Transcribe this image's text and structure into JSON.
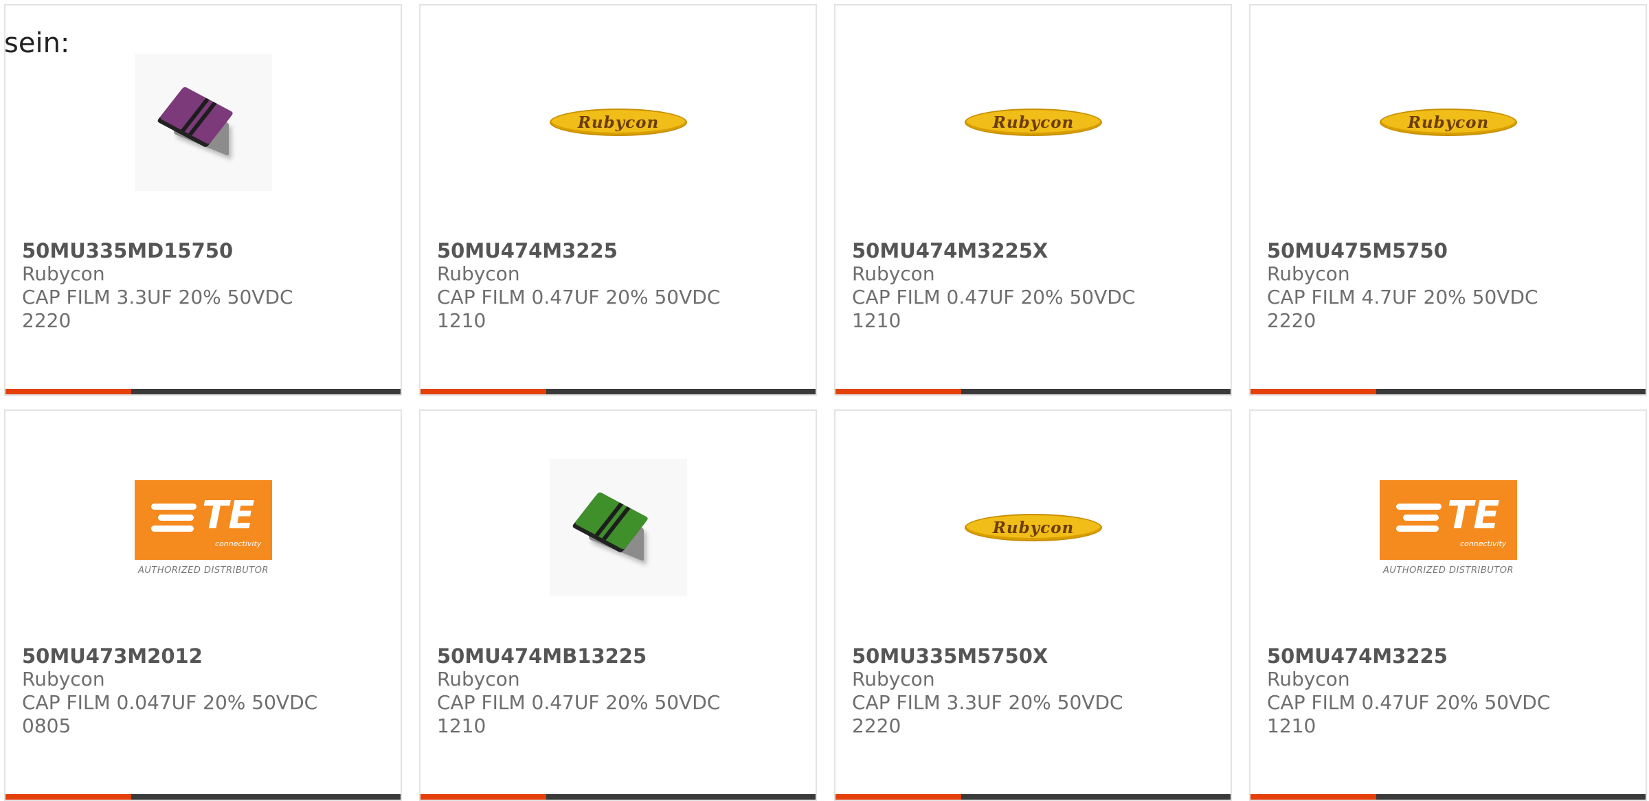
{
  "intro_text": "sein:",
  "colors": {
    "accent": "#e4400c",
    "bar": "#3a3a3a",
    "te_orange": "#f58a1f",
    "rubycon_yellow": "#f1bd18"
  },
  "products": [
    {
      "part": "50MU335MD15750",
      "brand": "Rubycon",
      "desc": "CAP FILM 3.3UF 20% 50VDC",
      "package": "2220",
      "image": "chip-purple"
    },
    {
      "part": "50MU474M3225",
      "brand": "Rubycon",
      "desc": "CAP FILM 0.47UF 20% 50VDC",
      "package": "1210",
      "image": "rubycon-logo",
      "logo_text": "Rubycon"
    },
    {
      "part": "50MU474M3225X",
      "brand": "Rubycon",
      "desc": "CAP FILM 0.47UF 20% 50VDC",
      "package": "1210",
      "image": "rubycon-logo",
      "logo_text": "Rubycon"
    },
    {
      "part": "50MU475M5750",
      "brand": "Rubycon",
      "desc": "CAP FILM 4.7UF 20% 50VDC",
      "package": "2220",
      "image": "rubycon-logo",
      "logo_text": "Rubycon"
    },
    {
      "part": "50MU473M2012",
      "brand": "Rubycon",
      "desc": "CAP FILM 0.047UF 20% 50VDC",
      "package": "0805",
      "image": "te-logo",
      "logo_text": "TE",
      "logo_sub": "connectivity",
      "logo_caption": "AUTHORIZED DISTRIBUTOR"
    },
    {
      "part": "50MU474MB13225",
      "brand": "Rubycon",
      "desc": "CAP FILM 0.47UF 20% 50VDC",
      "package": "1210",
      "image": "chip-green"
    },
    {
      "part": "50MU335M5750X",
      "brand": "Rubycon",
      "desc": "CAP FILM 3.3UF 20% 50VDC",
      "package": "2220",
      "image": "rubycon-logo",
      "logo_text": "Rubycon"
    },
    {
      "part": "50MU474M3225",
      "brand": "Rubycon",
      "desc": "CAP FILM 0.47UF 20% 50VDC",
      "package": "1210",
      "image": "te-logo",
      "logo_text": "TE",
      "logo_sub": "connectivity",
      "logo_caption": "AUTHORIZED DISTRIBUTOR"
    }
  ]
}
